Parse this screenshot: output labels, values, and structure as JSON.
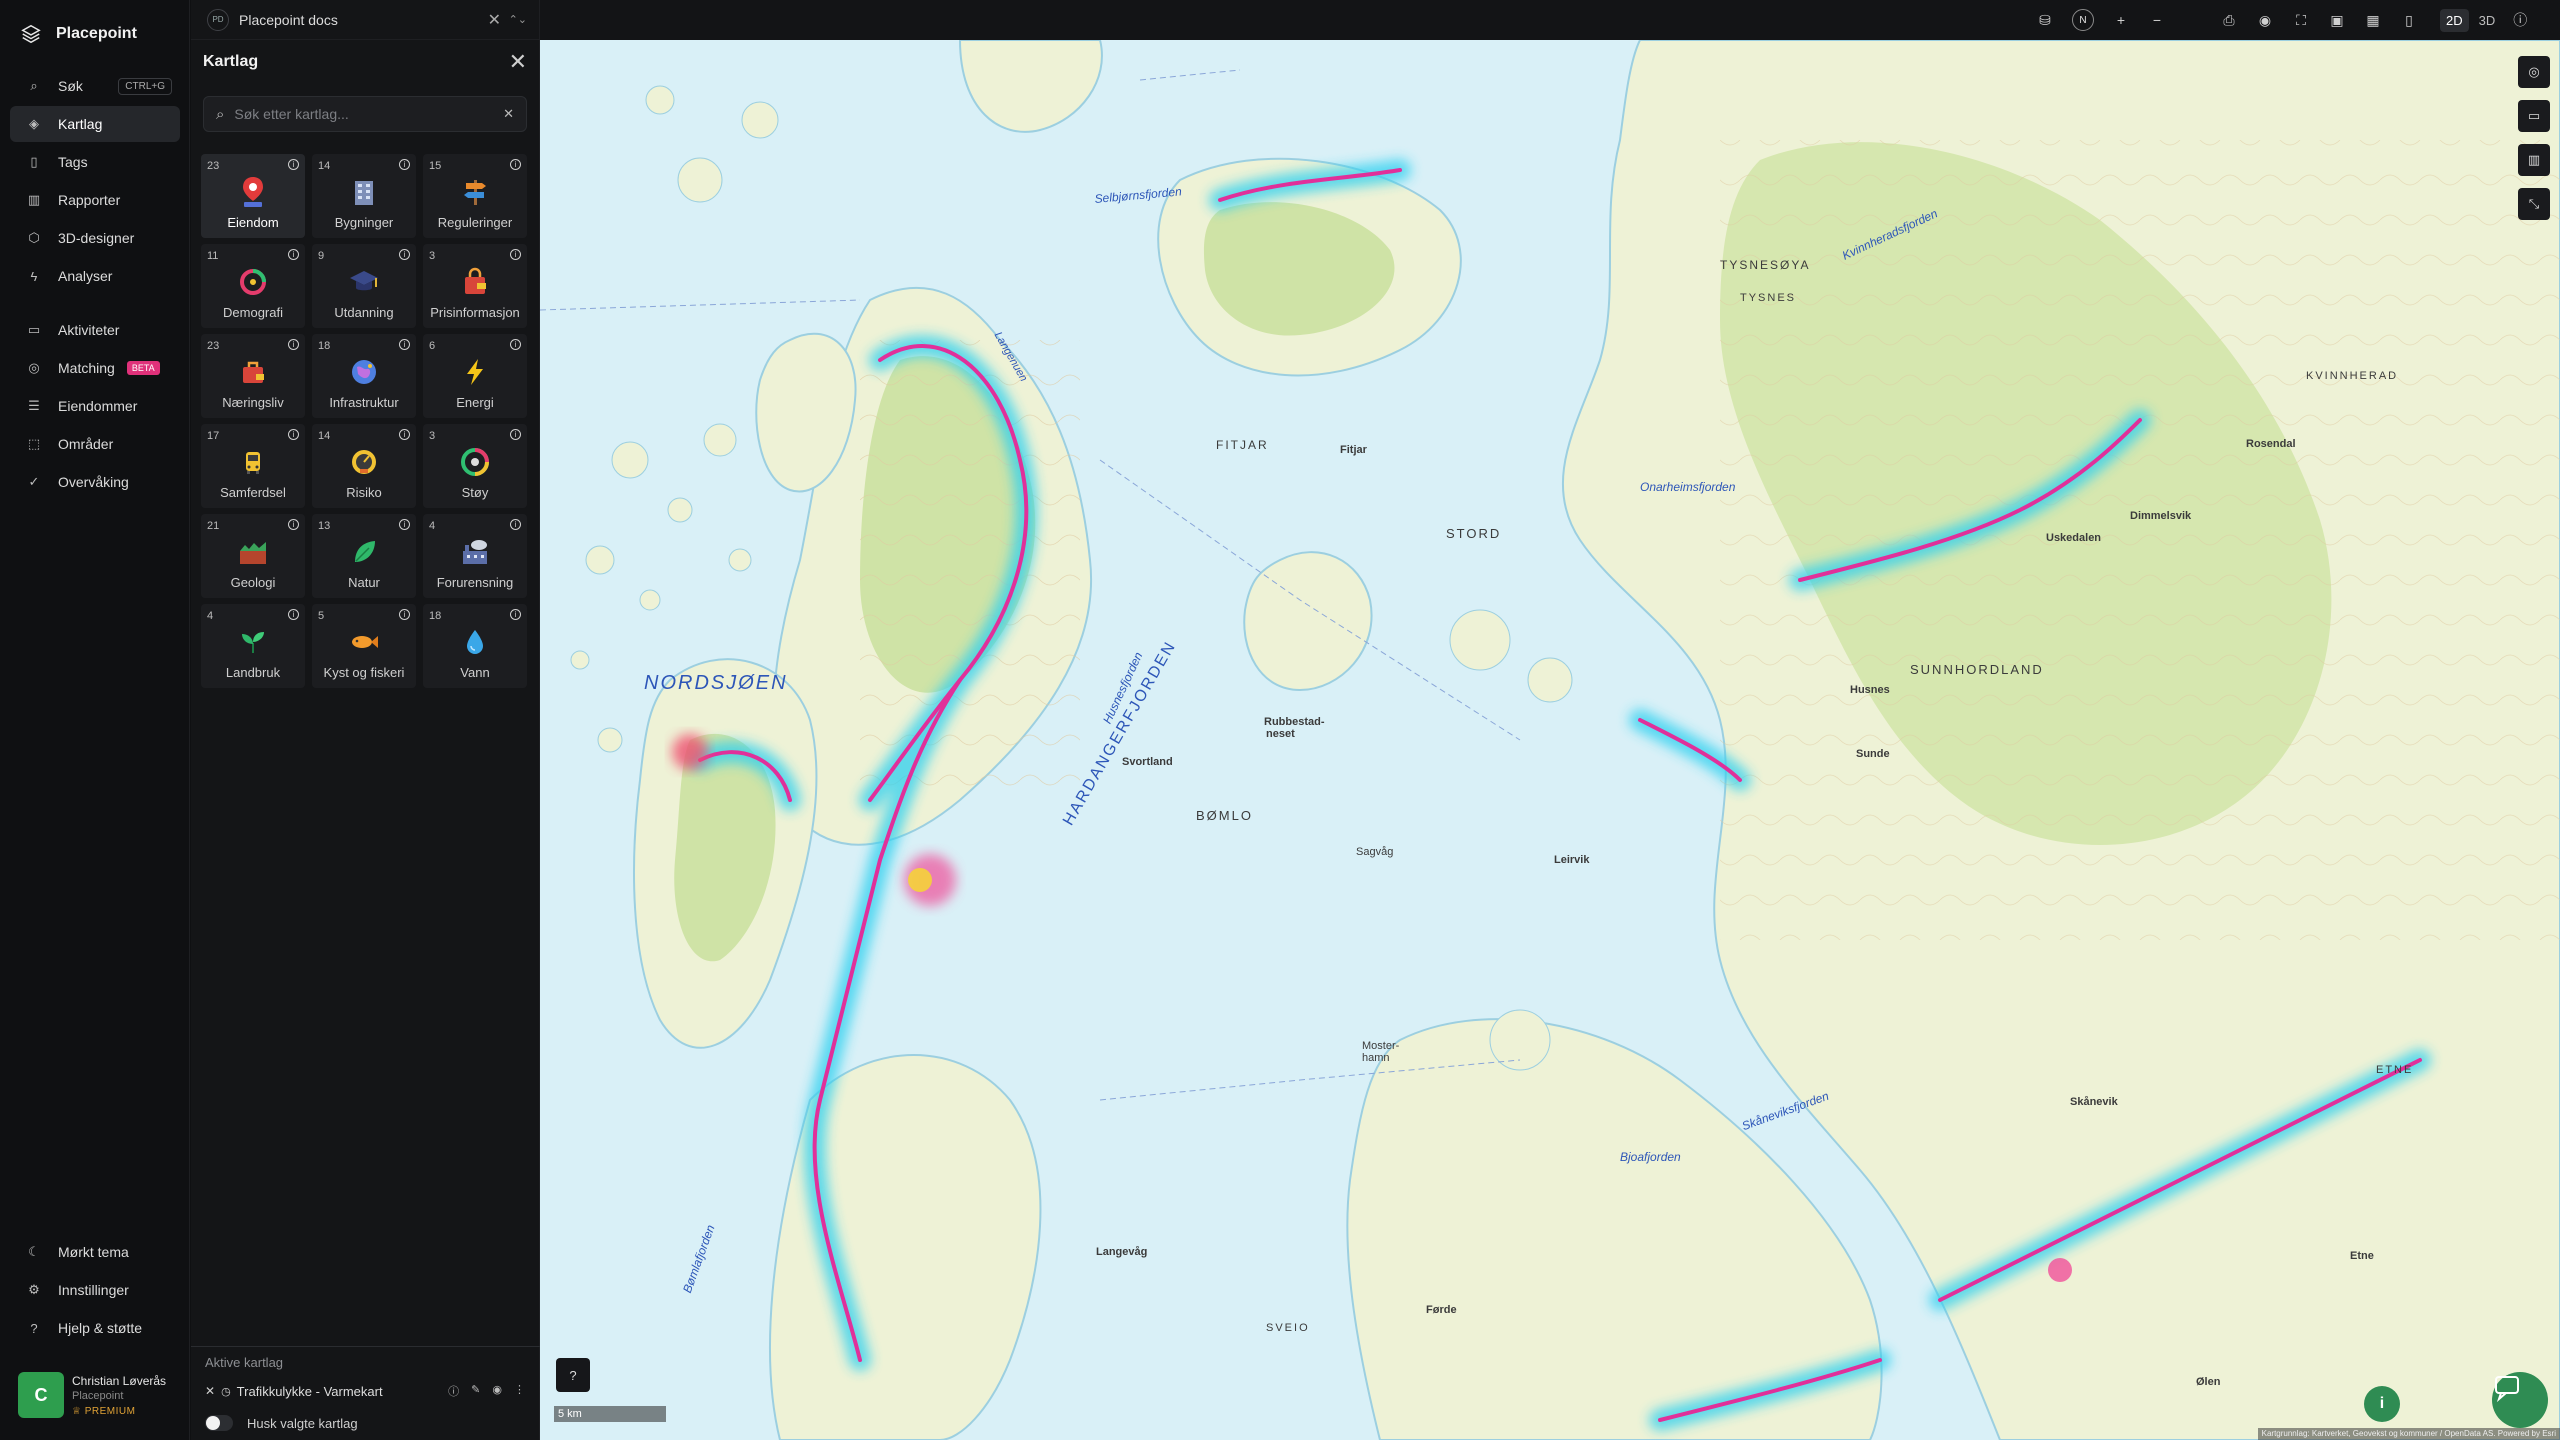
{
  "nav": {
    "brand": "Placepoint",
    "items": [
      {
        "label": "Søk",
        "shortcut": "CTRL+G"
      },
      {
        "label": "Kartlag"
      },
      {
        "label": "Tags"
      },
      {
        "label": "Rapporter"
      },
      {
        "label": "3D-designer"
      },
      {
        "label": "Analyser"
      },
      {
        "label": "Aktiviteter"
      },
      {
        "label": "Matching",
        "badge": "BETA"
      },
      {
        "label": "Eiendommer"
      },
      {
        "label": "Områder"
      },
      {
        "label": "Overvåking"
      }
    ],
    "bottom": [
      {
        "label": "Mørkt tema"
      },
      {
        "label": "Innstillinger"
      },
      {
        "label": "Hjelp & støtte"
      }
    ],
    "user": {
      "initial": "C",
      "name": "Christian Løverås",
      "company": "Placepoint",
      "plan": "PREMIUM"
    }
  },
  "panel": {
    "doc_logo": "PD",
    "doc_title": "Placepoint docs",
    "title": "Kartlag",
    "search_placeholder": "Søk etter kartlag...",
    "tiles": [
      {
        "count": "23",
        "label": "Eiendom"
      },
      {
        "count": "14",
        "label": "Bygninger"
      },
      {
        "count": "15",
        "label": "Reguleringer"
      },
      {
        "count": "11",
        "label": "Demografi"
      },
      {
        "count": "9",
        "label": "Utdanning"
      },
      {
        "count": "3",
        "label": "Prisinformasjon"
      },
      {
        "count": "23",
        "label": "Næringsliv"
      },
      {
        "count": "18",
        "label": "Infrastruktur"
      },
      {
        "count": "6",
        "label": "Energi"
      },
      {
        "count": "17",
        "label": "Samferdsel"
      },
      {
        "count": "14",
        "label": "Risiko"
      },
      {
        "count": "3",
        "label": "Støy"
      },
      {
        "count": "21",
        "label": "Geologi"
      },
      {
        "count": "13",
        "label": "Natur"
      },
      {
        "count": "4",
        "label": "Forurensning"
      },
      {
        "count": "4",
        "label": "Landbruk"
      },
      {
        "count": "5",
        "label": "Kyst og fiskeri"
      },
      {
        "count": "18",
        "label": "Vann"
      }
    ],
    "active_title": "Aktive kartlag",
    "active_layer": "Trafikkulykke - Varmekart",
    "remember_label": "Husk valgte kartlag"
  },
  "topbar": {
    "north": "N",
    "view_2d": "2D",
    "view_3d": "3D"
  },
  "map": {
    "water_labels": {
      "nordsjoen": "NORDSJØEN",
      "hardanger": "HARDANGERFJORDEN",
      "selbjorn": "Selbjørnsfjorden",
      "kvinnherad": "Kvinnheradsfjorden",
      "husnes": "Husnesfjorden",
      "skanevik": "Skåneviksfjorden",
      "bjoa": "Bjoafjorden",
      "bomla": "Bømlafjorden",
      "onarheim": "Onarheimsfjorden",
      "langenuen": "Langenuen"
    },
    "land_labels": {
      "stord": "STORD",
      "fitjar": "FITJAR",
      "bomlo": "BØMLO",
      "tysnesoy": "TYSNESØYA",
      "tysnes": "TYSNES",
      "sunnhordland": "SUNNHORDLAND",
      "kvinnherad": "KVINNHERAD",
      "etne": "ETNE",
      "sveio": "SVEIO",
      "rubbestad": "Rubbestad-",
      "rubbestad2": "neset",
      "svortland": "Svortland",
      "leirvik": "Leirvik",
      "sagvag": "Sagvåg",
      "fitjar_town": "Fitjar",
      "rosendal": "Rosendal",
      "husnes_town": "Husnes",
      "sunde": "Sunde",
      "mosterhamn": "Moster-",
      "mosterhamn2": "hamn",
      "forde": "Førde",
      "langevag": "Langevåg",
      "etne_town": "Etne",
      "skanevik_town": "Skånevik",
      "olen": "Ølen",
      "uskedalen": "Uskedalen",
      "dimmelsvik": "Dimmelsvik"
    },
    "scale_label": "5 km",
    "attribution": "Kartgrunnlag: Kartverket, Geovekst og kommuner / OpenData AS. Powered by Esri"
  },
  "colors": {
    "water": "#d9f0f7",
    "land": "#eef2d6",
    "forest": "#cfe3a6",
    "heat_cyan": "#2fd0f0",
    "heat_magenta": "#e0309a",
    "accent_green": "#2f8c53"
  }
}
